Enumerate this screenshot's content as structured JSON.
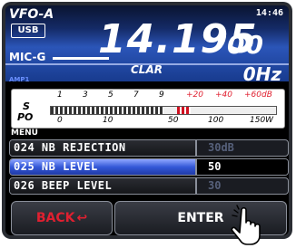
{
  "radio": {
    "vfo": "VFO-A",
    "time": "14:46",
    "mode": "USB",
    "mic": "MIC-G",
    "frequency_main": "14.195",
    "frequency_sub": "00",
    "amp": "AMP1",
    "clar_label": "CLAR",
    "clar_value": "0Hz"
  },
  "meter": {
    "s_label": "S",
    "po_label": "PO",
    "s_scale": [
      "1",
      "3",
      "5",
      "7",
      "9",
      "+20",
      "+40",
      "+60dB"
    ],
    "po_scale": [
      "0",
      "10",
      "50",
      "100",
      "150W"
    ],
    "level_fraction": 0.5
  },
  "menu": {
    "title": "MENU",
    "items": [
      {
        "number": "024",
        "name": "NB REJECTION",
        "value": "30dB",
        "selected": false
      },
      {
        "number": "025",
        "name": "NB LEVEL",
        "value": "50",
        "selected": true
      },
      {
        "number": "026",
        "name": "BEEP LEVEL",
        "value": "30",
        "selected": false
      }
    ]
  },
  "buttons": {
    "back": "BACK",
    "enter": "ENTER"
  },
  "icons": {
    "back_arrow": "return-arrow-icon",
    "pointer": "hand-pointer-icon"
  },
  "colors": {
    "accent_red": "#e02030",
    "selected_blue": "#3458d8"
  }
}
